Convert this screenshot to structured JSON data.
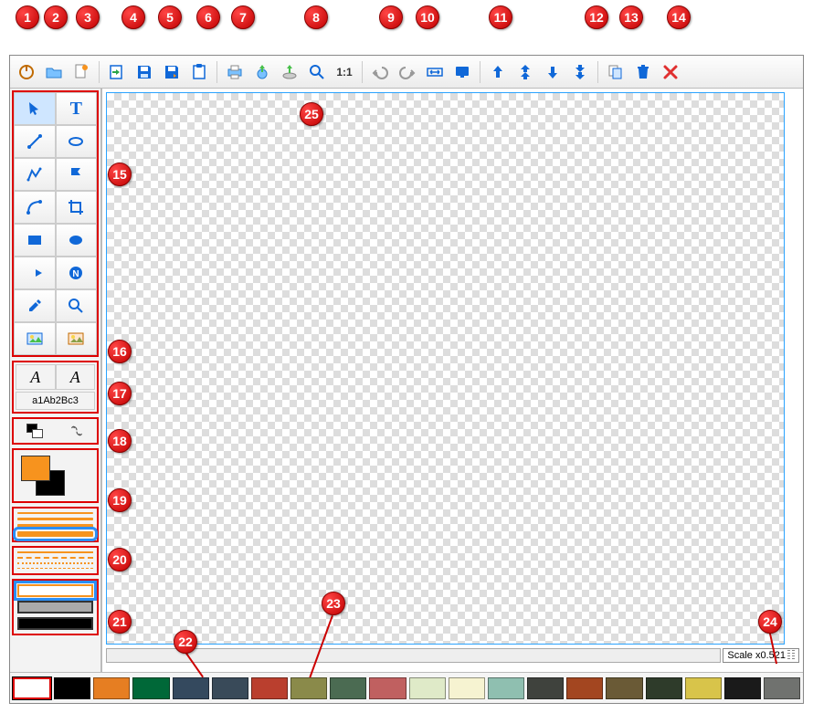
{
  "topbar": {
    "buttons": [
      {
        "name": "power-icon",
        "title": "Power / About"
      },
      {
        "name": "open-icon",
        "title": "Open"
      },
      {
        "name": "new-icon",
        "title": "New"
      },
      {
        "name": "import-icon",
        "title": "Import"
      },
      {
        "name": "save-icon",
        "title": "Save"
      },
      {
        "name": "save-as-icon",
        "title": "Save As"
      },
      {
        "name": "clipboard-icon",
        "title": "Clipboard"
      },
      {
        "name": "print-icon",
        "title": "Print"
      },
      {
        "name": "export-icon",
        "title": "Export"
      },
      {
        "name": "upload-icon",
        "title": "Upload"
      },
      {
        "name": "zoom-icon",
        "title": "Zoom"
      },
      {
        "name": "actual-size-icon",
        "title": "1:1"
      },
      {
        "name": "undo-icon",
        "title": "Undo"
      },
      {
        "name": "redo-icon",
        "title": "Redo"
      },
      {
        "name": "fit-width-icon",
        "title": "Fit Width"
      },
      {
        "name": "fit-screen-icon",
        "title": "Fit Screen"
      },
      {
        "name": "move-up-icon",
        "title": "Up"
      },
      {
        "name": "move-top-icon",
        "title": "To Top"
      },
      {
        "name": "move-down-icon",
        "title": "Down"
      },
      {
        "name": "move-bottom-icon",
        "title": "To Bottom"
      },
      {
        "name": "copy-icon",
        "title": "Copy"
      },
      {
        "name": "delete-icon",
        "title": "Delete"
      },
      {
        "name": "close-icon",
        "title": "Close"
      }
    ]
  },
  "tools": [
    {
      "name": "select-tool-icon",
      "title": "Select"
    },
    {
      "name": "text-tool-icon",
      "title": "Text",
      "glyph": "T"
    },
    {
      "name": "line-tool-icon",
      "title": "Line"
    },
    {
      "name": "ellipse-outline-tool-icon",
      "title": "Ellipse Outline"
    },
    {
      "name": "polyline-tool-icon",
      "title": "Polyline"
    },
    {
      "name": "flag-tool-icon",
      "title": "Flag"
    },
    {
      "name": "curve-tool-icon",
      "title": "Curve"
    },
    {
      "name": "crop-tool-icon",
      "title": "Crop"
    },
    {
      "name": "rectangle-tool-icon",
      "title": "Rectangle"
    },
    {
      "name": "ellipse-fill-tool-icon",
      "title": "Filled Ellipse"
    },
    {
      "name": "arrow-tool-icon",
      "title": "Arrow"
    },
    {
      "name": "number-tool-icon",
      "title": "Number Stamp",
      "glyph": "N"
    },
    {
      "name": "eyedropper-tool-icon",
      "title": "Color Picker"
    },
    {
      "name": "magnify-tool-icon",
      "title": "Magnifier"
    },
    {
      "name": "image-tool-icon",
      "title": "Image A"
    },
    {
      "name": "image2-tool-icon",
      "title": "Image B"
    }
  ],
  "font": {
    "style_a": "A",
    "style_b": "A",
    "sample": "a1Ab2Bc3"
  },
  "colors": {
    "foreground": "#f7931e",
    "background": "#000000"
  },
  "palette": [
    "#ffffff",
    "#000000",
    "#e67e22",
    "#006838",
    "#34495e",
    "#394a59",
    "#ba3f2e",
    "#8a8a4a",
    "#4b6b52",
    "#c06060",
    "#dfeac8",
    "#f6f3d1",
    "#8fbfb0",
    "#3f423d",
    "#a34620",
    "#6a5a36",
    "#2e3b2a",
    "#d8c44a",
    "#1a1a1a",
    "#70726f"
  ],
  "status": {
    "scale_label": "Scale x0.521"
  },
  "annotations": {
    "1": "1",
    "2": "2",
    "3": "3",
    "4": "4",
    "5": "5",
    "6": "6",
    "7": "7",
    "8": "8",
    "9": "9",
    "10": "10",
    "11": "11",
    "12": "12",
    "13": "13",
    "14": "14",
    "15": "15",
    "16": "16",
    "17": "17",
    "18": "18",
    "19": "19",
    "20": "20",
    "21": "21",
    "22": "22",
    "23": "23",
    "24": "24",
    "25": "25"
  }
}
